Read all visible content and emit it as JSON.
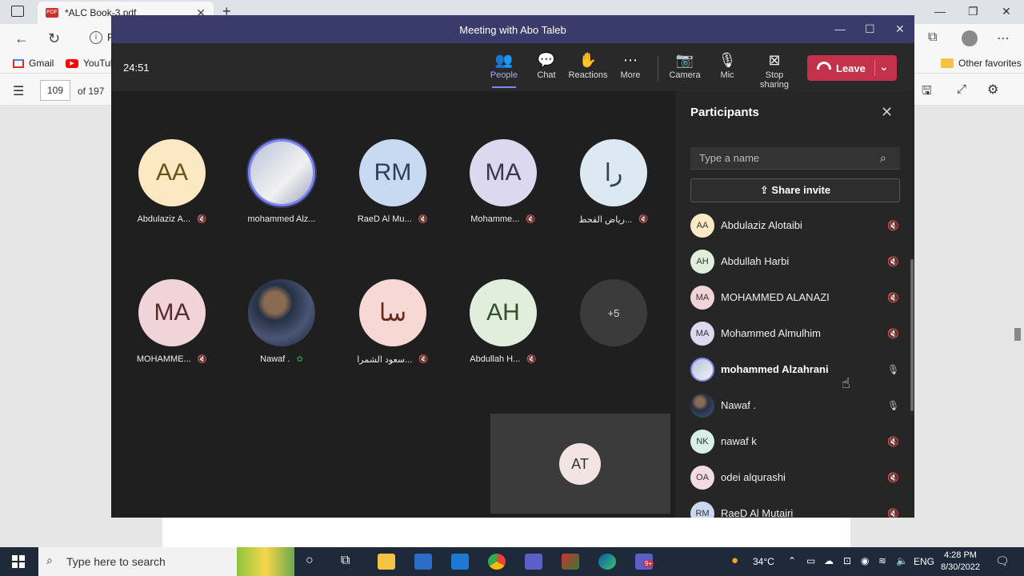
{
  "browser": {
    "tab_title": "*ALC Book-3.pdf",
    "tab_badge": "PDF",
    "url_fragment": "F",
    "bookmarks": [
      "Gmail",
      "YouTub",
      "Other favorites"
    ],
    "page_number": "109",
    "page_total": "of 197"
  },
  "meeting": {
    "title": "Meeting with Abo Taleb",
    "timer": "24:51",
    "toolbar": {
      "people": "People",
      "chat": "Chat",
      "reactions": "Reactions",
      "more": "More",
      "camera": "Camera",
      "mic": "Mic",
      "stop_sharing": "Stop sharing",
      "leave": "Leave"
    },
    "tiles": [
      {
        "initials": "AA",
        "name": "Abdulaziz A...",
        "color": "#fbe9c4"
      },
      {
        "initials": "",
        "name": "mohammed Alz...",
        "color": "#dfe4ef"
      },
      {
        "initials": "RM",
        "name": "RaeD Al Mu...",
        "color": "#c8daf1"
      },
      {
        "initials": "MA",
        "name": "Mohamme...",
        "color": "#dcd8ef"
      },
      {
        "initials": "را",
        "name": "رياض القحط...",
        "color": "#dde9f2"
      },
      {
        "initials": "MA",
        "name": "MOHAMME...",
        "color": "#f0d4d7"
      },
      {
        "initials": "",
        "name": "Nawaf .",
        "color": "#2a3346"
      },
      {
        "initials": "سا",
        "name": "سعود الشمرا...",
        "color": "#f8d8d2"
      },
      {
        "initials": "AH",
        "name": "Abdullah H...",
        "color": "#e0eedb"
      },
      {
        "initials": "+5",
        "name": "",
        "color": "#3b3b3b"
      }
    ],
    "self_initials": "AT"
  },
  "participants": {
    "title": "Participants",
    "search_placeholder": "Type a name",
    "share_invite": "Share invite",
    "list": [
      {
        "initials": "AA",
        "name": "Abdulaziz Alotaibi",
        "color": "#fbe9c4",
        "muted": true
      },
      {
        "initials": "AH",
        "name": "Abdullah Harbi",
        "color": "#e0eedb",
        "muted": true
      },
      {
        "initials": "MA",
        "name": "MOHAMMED ALANAZI",
        "color": "#f0d4d7",
        "muted": true
      },
      {
        "initials": "MA",
        "name": "Mohammed Almulhim",
        "color": "#dcd8ef",
        "muted": true
      },
      {
        "initials": "",
        "name": "mohammed Alzahrani",
        "color": "#c9cfdf",
        "muted": false
      },
      {
        "initials": "",
        "name": "Nawaf .",
        "color": "#384257",
        "muted": false
      },
      {
        "initials": "NK",
        "name": "nawaf k",
        "color": "#d7efe4",
        "muted": true
      },
      {
        "initials": "OA",
        "name": "odei alqurashi",
        "color": "#f3dbe6",
        "muted": true
      },
      {
        "initials": "RM",
        "name": "RaeD Al Mutairi",
        "color": "#c8daf1",
        "muted": true
      }
    ]
  },
  "taskbar": {
    "search_placeholder": "Type here to search",
    "temperature": "34°C",
    "language": "ENG",
    "time": "4:28 PM",
    "date": "8/30/2022",
    "teams_badge": "9+"
  }
}
